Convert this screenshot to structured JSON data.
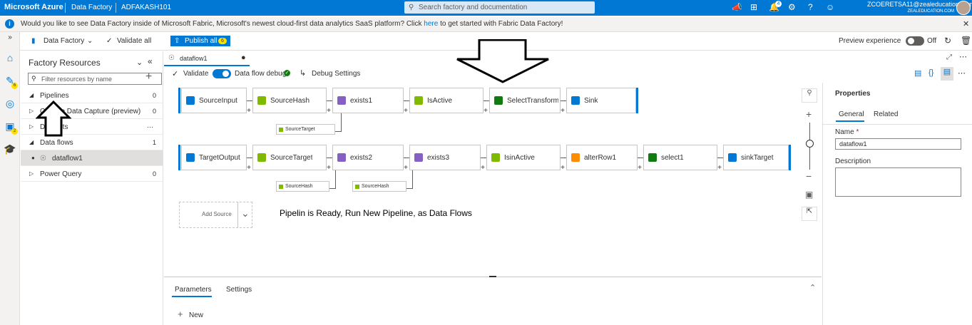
{
  "topbar": {
    "brand": "Microsoft Azure",
    "service": "Data Factory",
    "factory_name": "ADFAKASH101",
    "search_placeholder": "Search factory and documentation",
    "notification_count": "4",
    "user_name": "ZCOERETSA11@zealeducation.com",
    "user_org": "ZEALEDUCATION.COM"
  },
  "banner": {
    "message_before": "Would you like to see Data Factory inside of Microsoft Fabric, Microsoft's newest cloud-first data analytics SaaS platform? Click",
    "link": "here",
    "message_after": "to get started with Fabric Data Factory!"
  },
  "rail": {
    "author_badge": "6",
    "manage_badge": "2"
  },
  "toolbar": {
    "data_factory_label": "Data Factory",
    "validate_all_label": "Validate all",
    "publish_all_label": "Publish all",
    "publish_badge": "6",
    "preview_label": "Preview experience",
    "preview_state": "Off"
  },
  "resources": {
    "title": "Factory Resources",
    "filter_placeholder": "Filter resources by name",
    "items": [
      {
        "label": "Pipelines",
        "count": "0"
      },
      {
        "label": "Change Data Capture (preview)",
        "count": "0"
      },
      {
        "label": "Datasets",
        "count": ""
      },
      {
        "label": "Data flows",
        "count": "1"
      },
      {
        "label": "dataflow1",
        "count": ""
      },
      {
        "label": "Power Query",
        "count": "0"
      }
    ]
  },
  "editor": {
    "tab_label": "dataflow1",
    "validate_label": "Validate",
    "debug_label": "Data flow debug",
    "debug_settings_label": "Debug Settings"
  },
  "flow": {
    "row1": [
      "SourceInput",
      "SourceHash",
      "exists1",
      "IsActive",
      "SelectTransform...",
      "Sink"
    ],
    "row1_refs": [
      "SourceTarget"
    ],
    "row2": [
      "TargetOutput",
      "SourceTarget",
      "exists2",
      "exists3",
      "IsinActive",
      "alterRow1",
      "select1",
      "sinkTarget"
    ],
    "row2_refs": [
      "SourceHash",
      "SourceHash"
    ],
    "add_source_label": "Add Source",
    "annotation": "Pipelin is Ready, Run New Pipeline, as Data Flows"
  },
  "bottom": {
    "tabs": [
      "Parameters",
      "Settings"
    ],
    "new_label": "New"
  },
  "properties": {
    "title": "Properties",
    "tabs": [
      "General",
      "Related"
    ],
    "name_label": "Name",
    "required_mark": "*",
    "name_value": "dataflow1",
    "description_label": "Description"
  },
  "colors": {
    "accent": "#0078d4",
    "badge": "#fce100",
    "active_green": "#107c10"
  }
}
